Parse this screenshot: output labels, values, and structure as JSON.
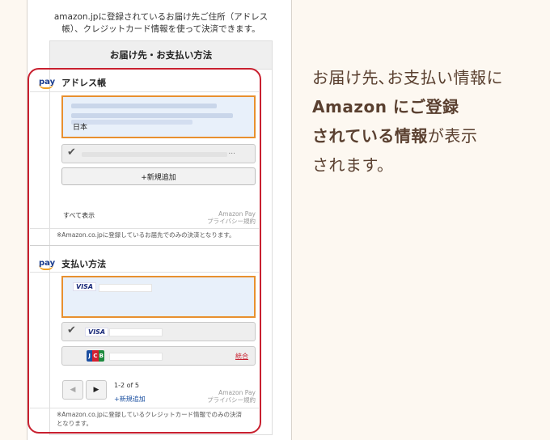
{
  "intro": {
    "line1": "amazon.jpに登録されているお届け先ご住所（アドレス",
    "line2": "帳）、クレジットカード情報を使って決済できます。"
  },
  "card_header": "お届け先・お支払い方法",
  "pay_logo": "pay",
  "address": {
    "title": "アドレス帳",
    "country": "日本",
    "ellipsis": "...",
    "new_button": "+新規追加",
    "show_all": "すべて表示",
    "amazon_pay": "Amazon Pay",
    "privacy": "プライバシー規約",
    "note": "※Amazon.co.jpに登録しているお届先でのみの決済となります。"
  },
  "payment": {
    "title": "支払い方法",
    "visa1": "VISA",
    "visa2": "VISA",
    "jcb": [
      "J",
      "C",
      "B"
    ],
    "merge_link": "統合",
    "pager_count": "1-2 of 5",
    "new_link": "+新規追加",
    "amazon_pay": "Amazon Pay",
    "privacy": "プライバシー規約",
    "note1": "※Amazon.co.jpに登録しているクレジットカード情報でのみの決済",
    "note2": "となります。"
  },
  "icons": {
    "check": "✔",
    "prev": "◀",
    "next": "▶"
  },
  "caption": {
    "part1": "お届け先､お支払い情報に",
    "part2_bold": "Amazon にご登録",
    "part3_bold": "されている情報",
    "part3_rest": "が表示",
    "part4": "されます。"
  },
  "colors": {
    "highlight": "#c8202f",
    "selected_border": "#e8902f",
    "selected_bg": "#e8f0fa",
    "caption_text": "#5a4030",
    "background": "#fdf8f1"
  }
}
